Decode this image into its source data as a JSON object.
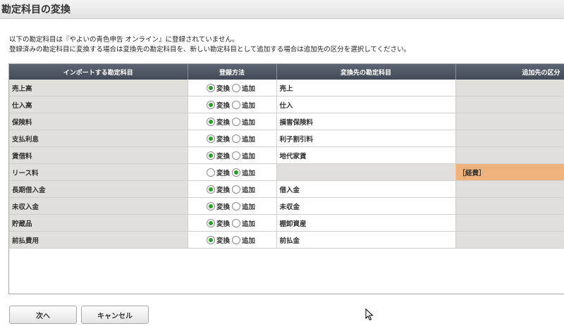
{
  "window": {
    "title": "勘定科目の変換"
  },
  "intro": {
    "line1": "以下の勘定科目は『やよいの青色申告 オンライン』に登録されていません。",
    "line2": "登録済みの勘定科目に変換する場合は変換先の勘定科目を、新しい勘定科目として追加する場合は追加先の区分を選択してください。"
  },
  "table": {
    "headers": [
      "インポートする勘定科目",
      "登録方法",
      "変換先の勘定科目",
      "追加先の区分"
    ],
    "option_convert": "変換",
    "option_add": "追加",
    "rows": [
      {
        "source": "売上高",
        "method": "convert",
        "target": "売上",
        "category": ""
      },
      {
        "source": "仕入高",
        "method": "convert",
        "target": "仕入",
        "category": ""
      },
      {
        "source": "保険料",
        "method": "convert",
        "target": "損害保険料",
        "category": ""
      },
      {
        "source": "支払利息",
        "method": "convert",
        "target": "利子割引料",
        "category": ""
      },
      {
        "source": "賃借料",
        "method": "convert",
        "target": "地代家賃",
        "category": ""
      },
      {
        "source": "リース料",
        "method": "add",
        "target": "",
        "category": "［経費］"
      },
      {
        "source": "長期借入金",
        "method": "convert",
        "target": "借入金",
        "category": ""
      },
      {
        "source": "未収入金",
        "method": "convert",
        "target": "未収金",
        "category": ""
      },
      {
        "source": "貯蔵品",
        "method": "convert",
        "target": "棚卸資産",
        "category": ""
      },
      {
        "source": "前払費用",
        "method": "convert",
        "target": "前払金",
        "category": ""
      }
    ]
  },
  "buttons": {
    "next": "次へ",
    "cancel": "キャンセル"
  },
  "colors": {
    "header_bg": "#4f5664",
    "selected_radio": "#2d9a2d",
    "active_category": "#efb27d"
  }
}
